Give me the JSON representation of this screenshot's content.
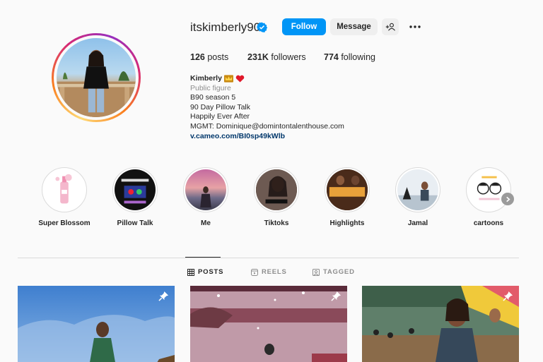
{
  "profile": {
    "username": "itskimberly90",
    "verified": true,
    "accent_color": "#0095f6",
    "buttons": {
      "follow": "Follow",
      "message": "Message"
    },
    "icons": {
      "add_user": "person-plus-icon",
      "more": "ellipsis-icon",
      "verified": "verified-badge-icon"
    }
  },
  "stats": {
    "posts_count": "126",
    "posts_label": " posts",
    "followers_count": "231K",
    "followers_label": " followers",
    "following_count": "774",
    "following_label": " following"
  },
  "bio": {
    "name": "Kimberly",
    "name_emojis": [
      "crown-icon",
      "red-heart-icon"
    ],
    "category": "Public figure",
    "lines": [
      "B90 season 5",
      "90 Day Pillow Talk",
      "Happily Ever After",
      "MGMT: Dominique@domintontalenthouse.com"
    ],
    "link": "v.cameo.com/BI0sp49kWlb"
  },
  "highlights": [
    {
      "label": "Super Blossom"
    },
    {
      "label": "Pillow Talk"
    },
    {
      "label": "Me"
    },
    {
      "label": "Tiktoks"
    },
    {
      "label": "Highlights"
    },
    {
      "label": "Jamal"
    },
    {
      "label": "cartoons"
    }
  ],
  "tabs": [
    {
      "label": "POSTS",
      "icon": "grid-icon",
      "active": true
    },
    {
      "label": "REELS",
      "icon": "reels-icon",
      "active": false
    },
    {
      "label": "TAGGED",
      "icon": "tagged-icon",
      "active": false
    }
  ],
  "posts": [
    {
      "pinned": true,
      "icon": "pin-icon"
    },
    {
      "pinned": true,
      "icon": "pin-icon"
    },
    {
      "pinned": true,
      "icon": "pin-icon"
    }
  ]
}
